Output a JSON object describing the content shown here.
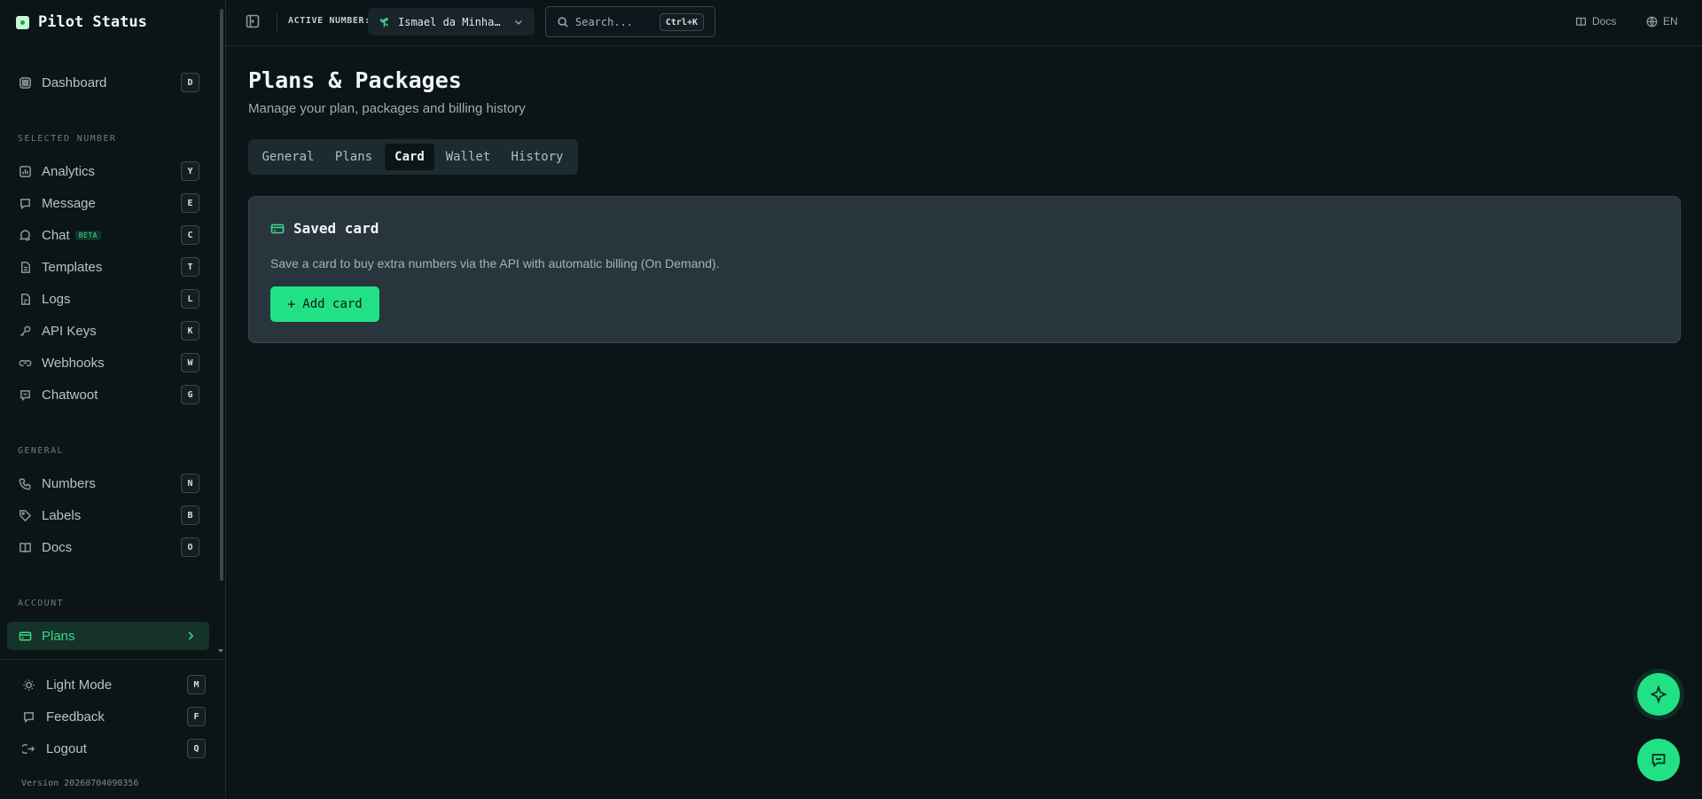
{
  "app": {
    "name": "Pilot Status",
    "version": "Version 20260704090356"
  },
  "sidebar": {
    "dashboard": {
      "label": "Dashboard",
      "key": "D"
    },
    "sections": {
      "selected_number": "SELECTED NUMBER",
      "general": "GENERAL",
      "account": "ACCOUNT"
    },
    "selected_items": [
      {
        "label": "Analytics",
        "key": "Y"
      },
      {
        "label": "Message",
        "key": "E"
      },
      {
        "label": "Chat",
        "key": "C",
        "badge": "BETA"
      },
      {
        "label": "Templates",
        "key": "T"
      },
      {
        "label": "Logs",
        "key": "L"
      },
      {
        "label": "API Keys",
        "key": "K"
      },
      {
        "label": "Webhooks",
        "key": "W"
      },
      {
        "label": "Chatwoot",
        "key": "G"
      }
    ],
    "general_items": [
      {
        "label": "Numbers",
        "key": "N"
      },
      {
        "label": "Labels",
        "key": "B"
      },
      {
        "label": "Docs",
        "key": "O"
      }
    ],
    "account_items": [
      {
        "label": "Plans",
        "active": true
      }
    ],
    "bottom_items": [
      {
        "label": "Light Mode",
        "key": "M"
      },
      {
        "label": "Feedback",
        "key": "F"
      },
      {
        "label": "Logout",
        "key": "Q"
      }
    ]
  },
  "header": {
    "active_number_label": "ACTIVE NUMBER:",
    "active_number_value": "Ismael da Minha…",
    "search_placeholder": "Search...",
    "search_shortcut": "Ctrl+K",
    "docs_label": "Docs",
    "lang_label": "EN"
  },
  "main": {
    "title": "Plans & Packages",
    "subtitle": "Manage your plan, packages and billing history",
    "tabs": [
      {
        "label": "General"
      },
      {
        "label": "Plans"
      },
      {
        "label": "Card",
        "active": true
      },
      {
        "label": "Wallet"
      },
      {
        "label": "History"
      }
    ],
    "card": {
      "title": "Saved card",
      "description": "Save a card to buy extra numbers via the API with automatic billing (On Demand).",
      "button_label": "Add card"
    }
  },
  "colors": {
    "accent": "#22e184",
    "background": "#0b1417",
    "panel": "#28353c"
  }
}
